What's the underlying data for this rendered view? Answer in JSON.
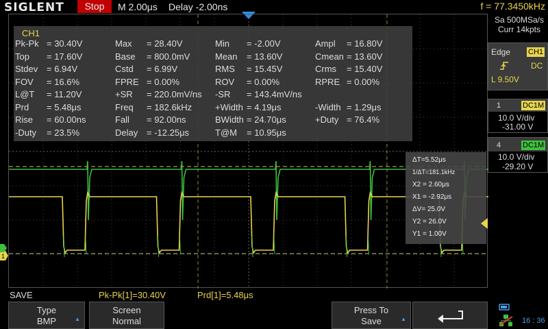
{
  "topbar": {
    "brand": "SIGLENT",
    "run_state": "Stop",
    "timebase": "M 2.00μs",
    "delay": "Delay -2.00ns",
    "frequency": "f = 77.3450kHz"
  },
  "acquisition": {
    "sample_rate": "Sa 500MSa/s",
    "memory": "Curr 14kpts"
  },
  "trigger": {
    "type": "Edge",
    "source": "CH1",
    "coupling": "DC",
    "level": "L  9.50V"
  },
  "channels": [
    {
      "num": "1",
      "coupling": "DC1M",
      "scale": "10.0 V/div",
      "offset": "-31.00 V",
      "color": "#e8d44d"
    },
    {
      "num": "4",
      "coupling": "DC1M",
      "scale": "10.0 V/div",
      "offset": "-29.20 V",
      "color": "#3fbf3f"
    }
  ],
  "measurements": {
    "channel": "CH1",
    "rows": [
      [
        [
          "Pk-Pk",
          "= 30.40V"
        ],
        [
          "Max",
          "= 28.40V"
        ],
        [
          "Min",
          "= -2.00V"
        ],
        [
          "Ampl",
          "= 16.80V"
        ]
      ],
      [
        [
          "Top",
          "= 17.60V"
        ],
        [
          "Base",
          "= 800.0mV"
        ],
        [
          "Mean",
          "= 13.60V"
        ],
        [
          "Cmean",
          "= 13.60V"
        ]
      ],
      [
        [
          "Stdev",
          "= 6.94V"
        ],
        [
          "Cstd",
          "= 6.99V"
        ],
        [
          "RMS",
          "= 15.45V"
        ],
        [
          "Crms",
          "= 15.40V"
        ]
      ],
      [
        [
          "FOV",
          "= 16.6%"
        ],
        [
          "FPRE",
          "= 0.00%"
        ],
        [
          "ROV",
          "= 0.00%"
        ],
        [
          "RPRE",
          "= 0.00%"
        ]
      ],
      [
        [
          "L@T",
          "= 11.20V"
        ],
        [
          "+SR",
          "= 220.0mV/ns"
        ],
        [
          "-SR",
          "= 143.4mV/ns"
        ],
        [
          "",
          ""
        ]
      ],
      [
        [
          "Prd",
          "= 5.48μs"
        ],
        [
          "Freq",
          "= 182.6kHz"
        ],
        [
          "+Width",
          "= 4.19μs"
        ],
        [
          "-Width",
          "= 1.29μs"
        ]
      ],
      [
        [
          "Rise",
          "= 60.00ns"
        ],
        [
          "Fall",
          "= 92.00ns"
        ],
        [
          "BWidth",
          "= 24.70μs"
        ],
        [
          "+Duty",
          "= 76.4%"
        ]
      ],
      [
        [
          "-Duty",
          "= 23.5%"
        ],
        [
          "Delay",
          "= -12.25μs"
        ],
        [
          "T@M",
          "= 10.95μs"
        ],
        [
          "",
          ""
        ]
      ]
    ]
  },
  "cursors": [
    "ΔT=5.52μs",
    "1/ΔT=181.1kHz",
    "X2 = 2.60μs",
    "X1 = -2.92μs",
    "ΔV= 25.0V",
    "Y2 = 26.0V",
    "Y1 = 1.00V"
  ],
  "status": {
    "mode": "SAVE",
    "pkpk": "Pk-Pk[1]=30.40V",
    "prd": "Prd[1]=5.48μs"
  },
  "softkeys": [
    {
      "title": "Type",
      "value": "BMP"
    },
    {
      "title": "Screen",
      "value": "Normal"
    },
    {
      "title": "",
      "value": ""
    },
    {
      "title": "Press To",
      "value": "Save"
    },
    {
      "title": "back-arrow",
      "value": ""
    }
  ],
  "clock": "16 : 36",
  "ch_markers": {
    "ch1": "1",
    "ch4": "4"
  }
}
